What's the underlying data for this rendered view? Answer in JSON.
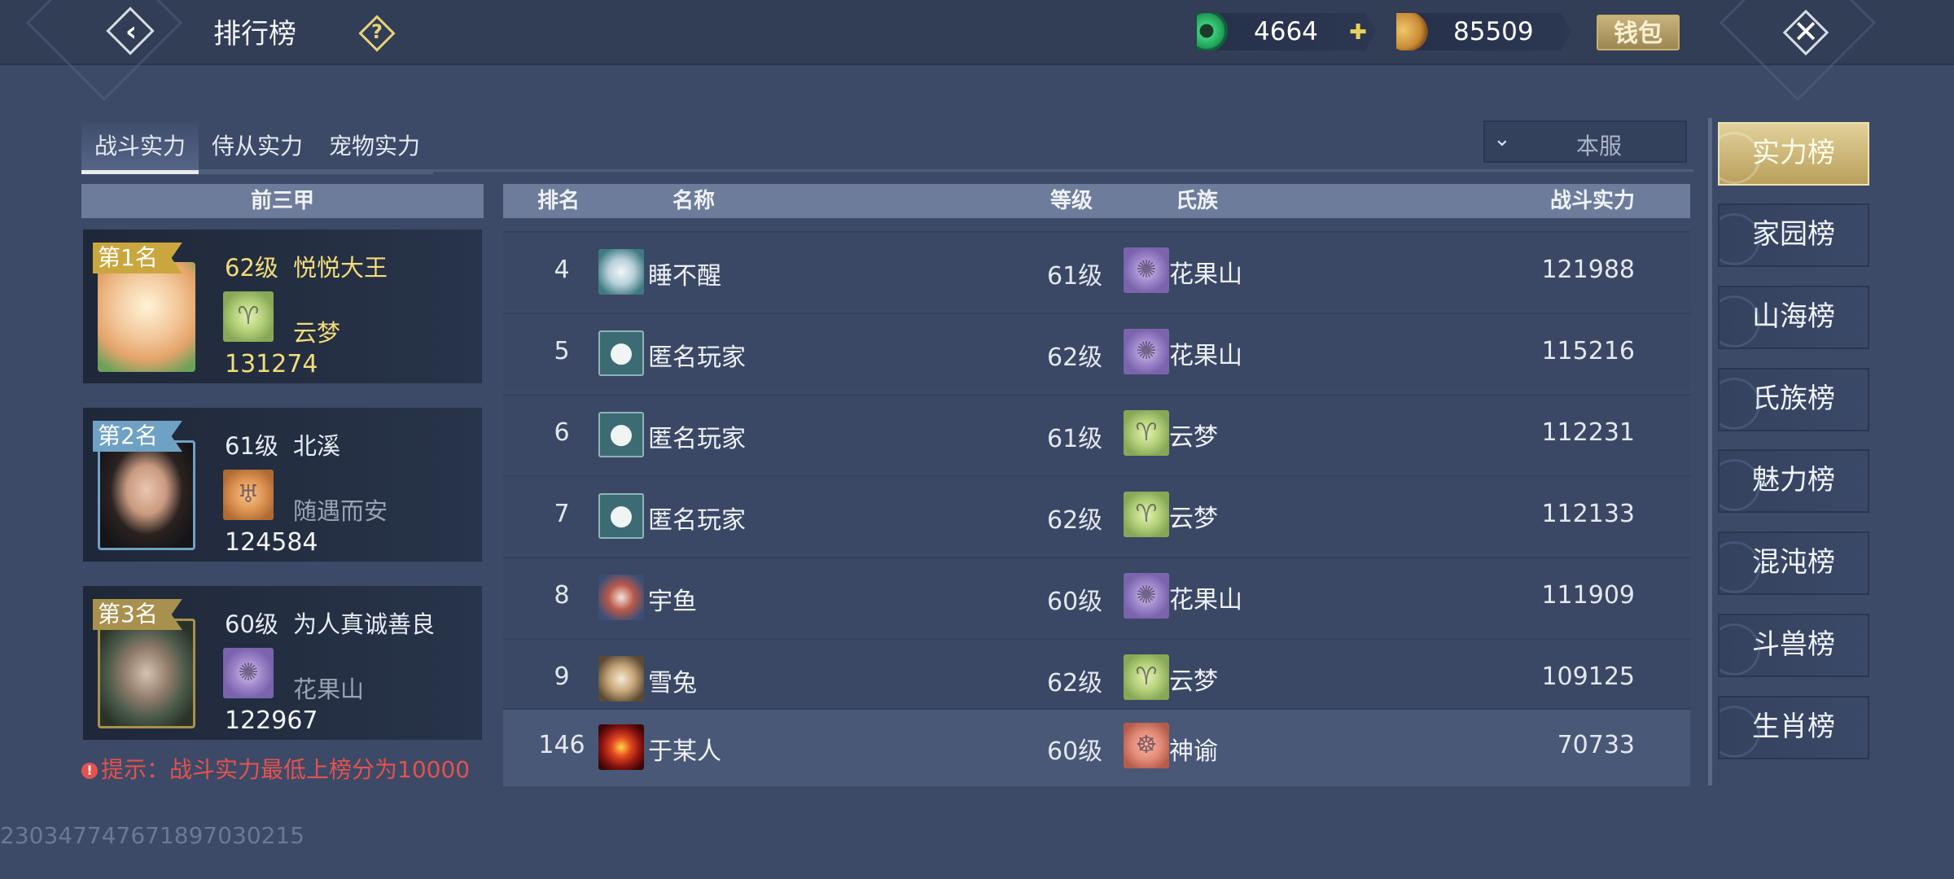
{
  "header": {
    "title": "排行榜",
    "help_icon": "question-icon",
    "jade_amount": "4664",
    "gold_amount": "85509",
    "wallet_label": "钱包"
  },
  "tabs": [
    {
      "label": "战斗实力",
      "active": true
    },
    {
      "label": "侍从实力",
      "active": false
    },
    {
      "label": "宠物实力",
      "active": false
    }
  ],
  "server_filter": {
    "value": "本服"
  },
  "top3": {
    "heading": "前三甲",
    "entries": [
      {
        "rank_label": "第1名",
        "level": "62级",
        "name": "悦悦大王",
        "clan": "云梦",
        "power": "131274",
        "tag_color": "#c9a73e",
        "name_color": "#f3dc79"
      },
      {
        "rank_label": "第2名",
        "level": "61级",
        "name": "北溪",
        "clan": "随遇而安",
        "power": "124584",
        "tag_color": "#6fa1c4",
        "name_color": "#f2f4f8"
      },
      {
        "rank_label": "第3名",
        "level": "60级",
        "name": "为人真诚善良",
        "clan": "花果山",
        "power": "122967",
        "tag_color": "#a8914e",
        "name_color": "#f2f4f8"
      }
    ]
  },
  "hint": {
    "text": "提示：战斗实力最低上榜分为10000"
  },
  "table": {
    "headers": {
      "rank": "排名",
      "name": "名称",
      "level": "等级",
      "clan": "氏族",
      "power": "战斗实力"
    },
    "rows": [
      {
        "rank": "4",
        "name": "睡不醒",
        "level": "61级",
        "clan": "花果山",
        "power": "121988"
      },
      {
        "rank": "5",
        "name": "匿名玩家",
        "level": "62级",
        "clan": "花果山",
        "power": "115216"
      },
      {
        "rank": "6",
        "name": "匿名玩家",
        "level": "61级",
        "clan": "云梦",
        "power": "112231"
      },
      {
        "rank": "7",
        "name": "匿名玩家",
        "level": "62级",
        "clan": "云梦",
        "power": "112133"
      },
      {
        "rank": "8",
        "name": "宇鱼",
        "level": "60级",
        "clan": "花果山",
        "power": "111909"
      },
      {
        "rank": "9",
        "name": "雪兔",
        "level": "62级",
        "clan": "云梦",
        "power": "109125"
      }
    ],
    "self_row": {
      "rank": "146",
      "name": "于某人",
      "level": "60级",
      "clan": "神谕",
      "power": "70733"
    }
  },
  "sidebar": {
    "items": [
      {
        "label": "实力榜",
        "active": true
      },
      {
        "label": "家园榜",
        "active": false
      },
      {
        "label": "山海榜",
        "active": false
      },
      {
        "label": "氏族榜",
        "active": false
      },
      {
        "label": "魅力榜",
        "active": false
      },
      {
        "label": "混沌榜",
        "active": false
      },
      {
        "label": "斗兽榜",
        "active": false
      },
      {
        "label": "生肖榜",
        "active": false
      }
    ]
  },
  "footer": {
    "uid": "2303477476718970302​15"
  }
}
